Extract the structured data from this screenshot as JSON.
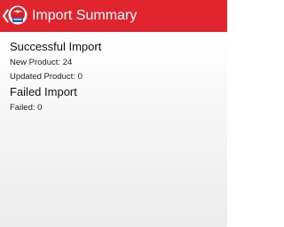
{
  "header": {
    "title": "Import Summary",
    "accent_color": "#e1252f",
    "back_icon": "chevron-left-icon",
    "logo_icon": "app-logo-icon"
  },
  "successful": {
    "heading": "Successful Import",
    "new_product_label": "New Product: ",
    "new_product_value": "24",
    "updated_product_label": "Updated Product: ",
    "updated_product_value": "0"
  },
  "failed": {
    "heading": "Failed Import",
    "failed_label": "Failed: ",
    "failed_value": "0"
  }
}
